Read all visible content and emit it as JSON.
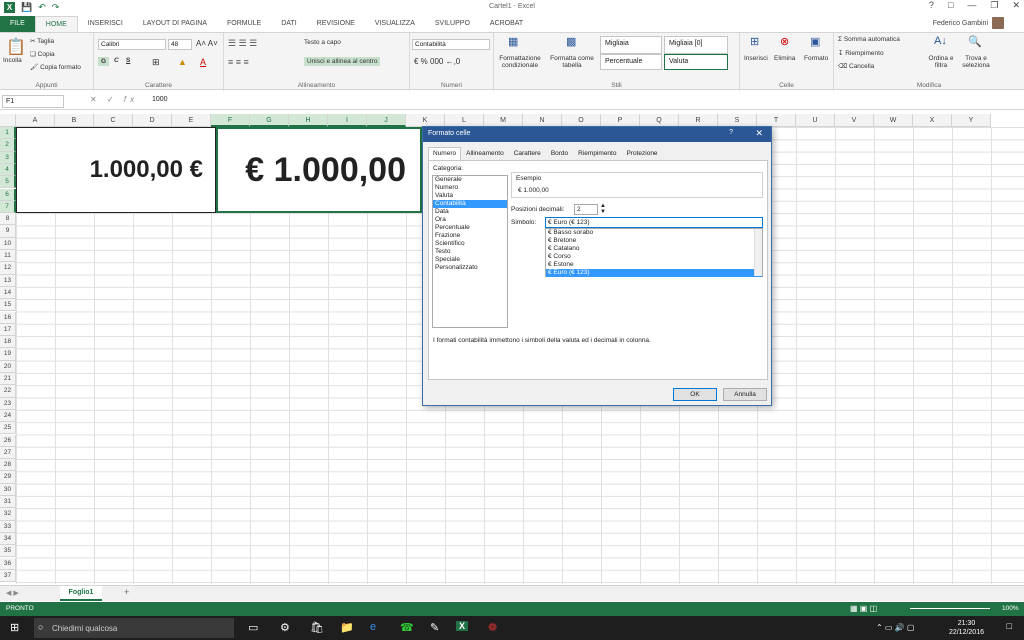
{
  "window": {
    "title": "Cartel1 - Excel",
    "user": "Federico Gambini"
  },
  "qat": {
    "logo": "X",
    "save": "save-icon",
    "undo": "undo-icon",
    "redo": "redo-icon"
  },
  "tabs": [
    "FILE",
    "HOME",
    "INSERISCI",
    "LAYOUT DI PAGINA",
    "FORMULE",
    "DATI",
    "REVISIONE",
    "VISUALIZZA",
    "SVILUPPO",
    "ACROBAT"
  ],
  "ribbon": {
    "clipboard": {
      "paste": "Incolla",
      "cut": "Taglia",
      "copy": "Copia",
      "format_painter": "Copia formato",
      "label": "Appunti"
    },
    "font": {
      "name": "Calibri",
      "size": "48",
      "bold": "G",
      "italic": "C",
      "underline": "S",
      "label": "Carattere"
    },
    "alignment": {
      "wrap": "Testo a capo",
      "merge": "Unisci e allinea al centro",
      "label": "Allineamento"
    },
    "number": {
      "format": "Contabilità",
      "label": "Numeri"
    },
    "styles": {
      "cond": "Formattazione condizionale",
      "table": "Formatta come tabella",
      "s1": "Migliaia",
      "s2": "Migliaia [0]",
      "s3": "Percentuale",
      "s4": "Valuta",
      "label": "Stili"
    },
    "cells": {
      "insert": "Inserisci",
      "delete": "Elimina",
      "format": "Formato",
      "label": "Celle"
    },
    "editing": {
      "autosum": "Somma automatica",
      "fill": "Riempimento",
      "clear": "Cancella",
      "sort": "Ordina e filtra",
      "find": "Trova e seleziona",
      "label": "Modifica"
    }
  },
  "formula": {
    "namebox": "F1",
    "fx": "fx",
    "content": "1000"
  },
  "columns": [
    "A",
    "B",
    "C",
    "D",
    "E",
    "F",
    "G",
    "H",
    "I",
    "J",
    "K",
    "L",
    "M",
    "N",
    "O",
    "P",
    "Q",
    "R",
    "S",
    "T",
    "U",
    "V",
    "W",
    "X",
    "Y"
  ],
  "rows": [
    "1",
    "2",
    "3",
    "4",
    "5",
    "6",
    "7",
    "8",
    "9",
    "10",
    "11",
    "12",
    "13",
    "14",
    "15",
    "16",
    "17",
    "18",
    "19",
    "20",
    "21",
    "22",
    "23",
    "24",
    "25",
    "26",
    "27",
    "28",
    "29",
    "30",
    "31",
    "32",
    "33",
    "34",
    "35",
    "36",
    "37"
  ],
  "cells": {
    "merged1": "1.000,00 €",
    "merged2": "€ 1.000,00"
  },
  "dialog": {
    "title": "Formato celle",
    "help": "?",
    "tabs": [
      "Numero",
      "Allineamento",
      "Carattere",
      "Bordo",
      "Riempimento",
      "Protezione"
    ],
    "category_label": "Categoria:",
    "categories": [
      "Generale",
      "Numero",
      "Valuta",
      "Contabilità",
      "Data",
      "Ora",
      "Percentuale",
      "Frazione",
      "Scientifico",
      "Testo",
      "Speciale",
      "Personalizzato"
    ],
    "sample_label": "Esempio",
    "sample_value": "€ 1.000,00",
    "decimals_label": "Posizioni decimali:",
    "decimals_value": "2",
    "symbol_label": "Simbolo:",
    "symbol_value": "€ Euro (€ 123)",
    "symbol_options": [
      "€ Basso sorabo",
      "€ Bretone",
      "€ Catalano",
      "€ Corso",
      "€ Estone",
      "€ Euro (€ 123)"
    ],
    "description": "I formati contabilità immettono i simboli della valuta ed i decimali in colonna.",
    "ok": "OK",
    "cancel": "Annulla"
  },
  "sheet": {
    "tab": "Foglio1",
    "add": "+"
  },
  "status": {
    "ready": "PRONTO",
    "zoom": "100%"
  },
  "taskbar": {
    "search": "Chiedimi qualcosa",
    "time": "21:30",
    "date": "22/12/2016"
  }
}
